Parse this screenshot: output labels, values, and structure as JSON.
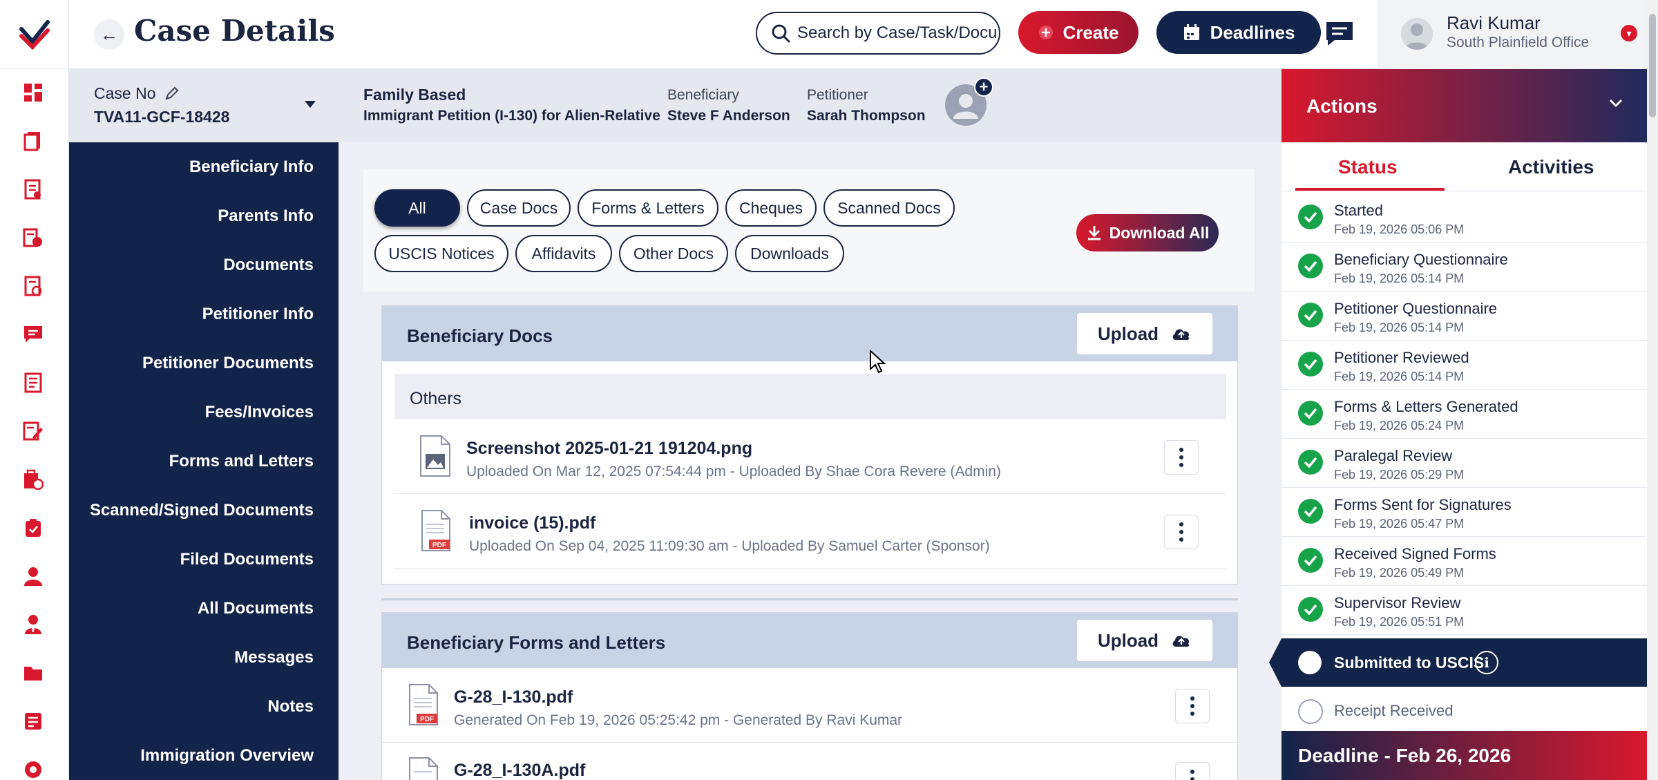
{
  "header": {
    "page_title": "Case Details",
    "search_placeholder": "Search by Case/Task/Document",
    "create_label": "Create",
    "deadlines_label": "Deadlines",
    "user_name": "Ravi Kumar",
    "user_office": "South Plainfield Office"
  },
  "case": {
    "case_no_label": "Case No",
    "case_no": "TVA11-GCF-18428",
    "family_title": "Family Based",
    "petition_type": "Immigrant Petition (I-130) for Alien-Relative",
    "beneficiary_label": "Beneficiary",
    "beneficiary_name": "Steve F Anderson",
    "petitioner_label": "Petitioner",
    "petitioner_name": "Sarah Thompson"
  },
  "subnav": [
    "Beneficiary Info",
    "Parents Info",
    "Documents",
    "Petitioner Info",
    "Petitioner Documents",
    "Fees/Invoices",
    "Forms and Letters",
    "Scanned/Signed Documents",
    "Filed Documents",
    "All Documents",
    "Messages",
    "Notes",
    "Immigration Overview"
  ],
  "filters": {
    "chips": [
      "All",
      "Case Docs",
      "Forms & Letters",
      "Cheques",
      "Scanned Docs",
      "USCIS Notices",
      "Affidavits",
      "Other Docs",
      "Downloads"
    ],
    "active": "All",
    "download_all_label": "Download All"
  },
  "sections": [
    {
      "title": "Beneficiary Docs",
      "upload_label": "Upload",
      "group": "Others",
      "files": [
        {
          "name": "Screenshot 2025-01-21 191204.png",
          "meta": "Uploaded On Mar 12, 2025 07:54:44 pm - Uploaded By Shae Cora Revere (Admin)"
        },
        {
          "name": "invoice (15).pdf",
          "meta": "Uploaded On Sep 04, 2025 11:09:30 am - Uploaded By Samuel Carter (Sponsor)"
        }
      ]
    },
    {
      "title": "Beneficiary Forms and Letters",
      "upload_label": "Upload",
      "files": [
        {
          "name": "G-28_I-130.pdf",
          "meta": "Generated On Feb 19, 2026 05:25:42 pm - Generated By Ravi Kumar"
        },
        {
          "name": "G-28_I-130A.pdf",
          "meta": ""
        }
      ]
    }
  ],
  "actions": {
    "title": "Actions",
    "tab_status": "Status",
    "tab_activities": "Activities",
    "steps": [
      {
        "title": "Started",
        "date": "Feb 19, 2026 05:06 PM"
      },
      {
        "title": "Beneficiary Questionnaire",
        "date": "Feb 19, 2026 05:14 PM"
      },
      {
        "title": "Petitioner Questionnaire",
        "date": "Feb 19, 2026 05:14 PM"
      },
      {
        "title": "Petitioner Reviewed",
        "date": "Feb 19, 2026 05:14 PM"
      },
      {
        "title": "Forms & Letters Generated",
        "date": "Feb 19, 2026 05:24 PM"
      },
      {
        "title": "Paralegal Review",
        "date": "Feb 19, 2026 05:29 PM"
      },
      {
        "title": "Forms Sent for Signatures",
        "date": "Feb 19, 2026 05:47 PM"
      },
      {
        "title": "Received Signed Forms",
        "date": "Feb 19, 2026 05:49 PM"
      },
      {
        "title": "Supervisor Review",
        "date": "Feb 19, 2026 05:51 PM"
      }
    ],
    "current_step": "Submitted to USCIS",
    "pending_step": "Receipt Received",
    "deadline": "Deadline - Feb 26, 2026"
  },
  "colors": {
    "navy": "#13244a",
    "brand_red": "#d8182d",
    "success_green": "#17a34a"
  },
  "icons": {
    "rail": [
      "dashboard-icon",
      "cases-icon",
      "forms-icon",
      "invoices-icon",
      "documents-check-icon",
      "messages-icon",
      "notes-icon",
      "edit-list-icon",
      "payments-icon",
      "clipboard-icon",
      "user-icon",
      "user-tie-icon",
      "folder-icon",
      "reports-icon",
      "settings-icon"
    ]
  }
}
